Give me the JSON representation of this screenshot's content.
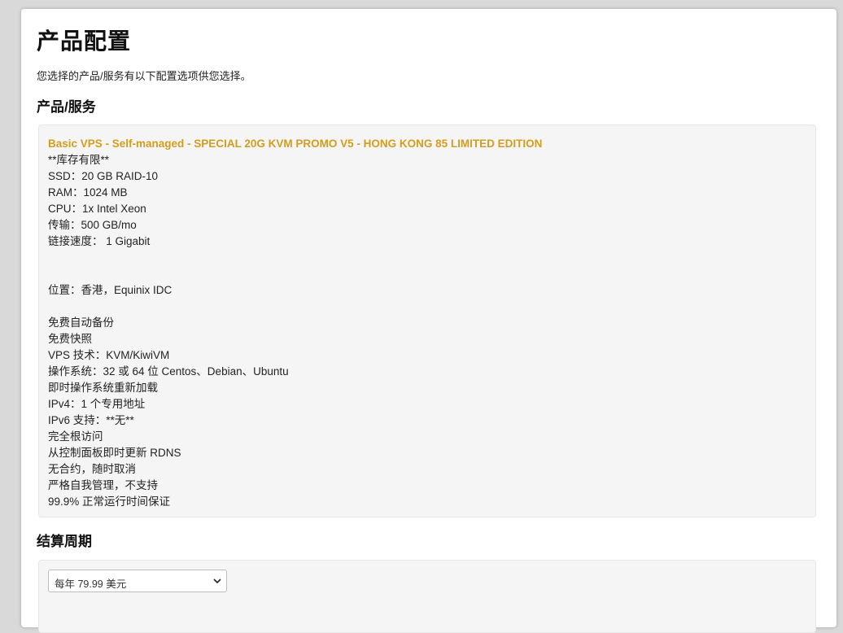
{
  "page": {
    "title": "产品配置",
    "intro": "您选择的产品/服务有以下配置选项供您选择。"
  },
  "product_section": {
    "heading": "产品/服务",
    "name": "Basic VPS - Self-managed - SPECIAL 20G KVM PROMO V5 - HONG KONG 85 LIMITED EDITION",
    "lines": [
      "**库存有限**",
      "SSD：20 GB RAID-10",
      "RAM：1024 MB",
      "CPU：1x Intel Xeon",
      "传输：500 GB/mo",
      "链接速度：  1 Gigabit",
      "",
      "",
      "位置：香港，Equinix IDC",
      "",
      "免费自动备份",
      "免费快照",
      "VPS 技术：KVM/KiwiVM",
      "操作系统：32 或 64 位 Centos、Debian、Ubuntu",
      "即时操作系统重新加载",
      "IPv4：1 个专用地址",
      "IPv6 支持：**无**",
      "完全根访问",
      "从控制面板即时更新 RDNS",
      "无合约，随时取消",
      "严格自我管理，不支持",
      "99.9% 正常运行时间保证"
    ]
  },
  "billing_section": {
    "heading": "结算周期",
    "selected_cycle": "每年 79.99 美元"
  },
  "colors": {
    "product_name": "#d39d1f",
    "background": "#d9d9d9",
    "panel": "#ffffff",
    "box": "#f5f5f5"
  },
  "icons": {
    "select_arrow": "chevron-down-icon"
  }
}
